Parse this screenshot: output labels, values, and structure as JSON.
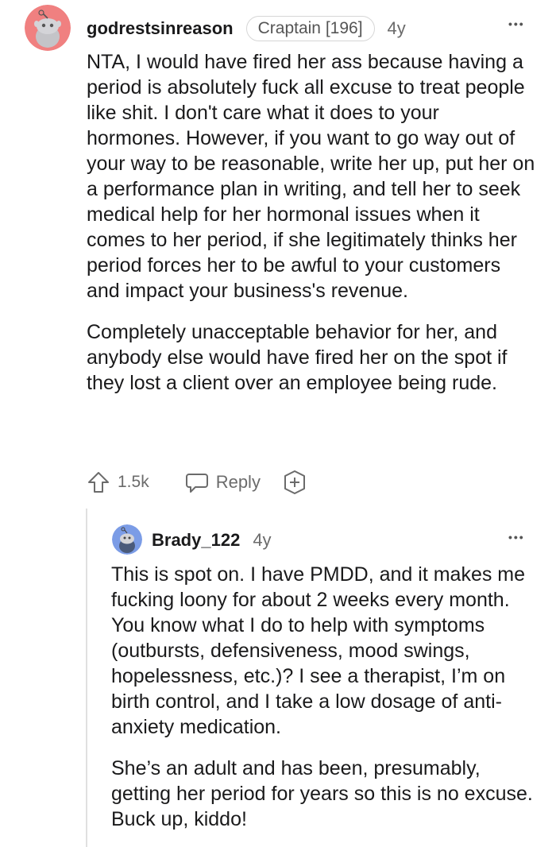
{
  "comments": [
    {
      "username": "godrestsinreason",
      "flair": "Craptain [196]",
      "age": "4y",
      "paragraphs": [
        "NTA, I would have fired her ass because having a period is absolutely fuck all excuse to treat people like shit. I don't care what it does to your hormones. However, if you want to go way out of your way to be reasonable, write her up, put her on a performance plan in writing, and tell her to seek medical help for her hormonal issues when it comes to her period, if she legitimately thinks her period forces her to be awful to your customers and impact your business's revenue.",
        "Completely unacceptable behavior for her, and anybody else would have fired her on the spot if they lost a client over an employee being rude."
      ],
      "upvotes": "1.5k",
      "reply_label": "Reply",
      "more_label": "•••",
      "avatar_color": "#f08080",
      "icons": [
        "upvote-icon",
        "reply-icon",
        "award-icon",
        "more-icon"
      ]
    },
    {
      "username": "Brady_122",
      "age": "4y",
      "paragraphs": [
        "This is spot on. I have PMDD, and it makes me fucking loony for about 2 weeks every month. You know what I do to help with symptoms (outbursts, defensiveness, mood swings, hopelessness, etc.)? I see a therapist, I’m on birth control, and I take a low dosage of anti-anxiety medication.",
        "She’s an adult and has been, presumably, getting her period for years so this is no excuse. Buck up, kiddo!"
      ],
      "more_label": "•••",
      "avatar_color": "#7b9ce6",
      "icons": [
        "more-icon"
      ]
    }
  ]
}
